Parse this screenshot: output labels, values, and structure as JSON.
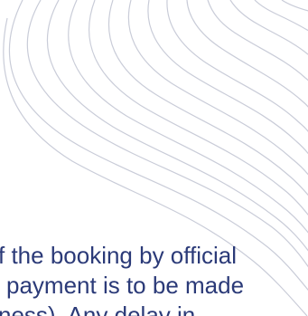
{
  "document": {
    "lines": [
      "f the booking by official",
      "l payment is to be made",
      "ness). Any delay in"
    ],
    "text_color": "#2b3a78",
    "decor_color": "#c9ccd8"
  }
}
